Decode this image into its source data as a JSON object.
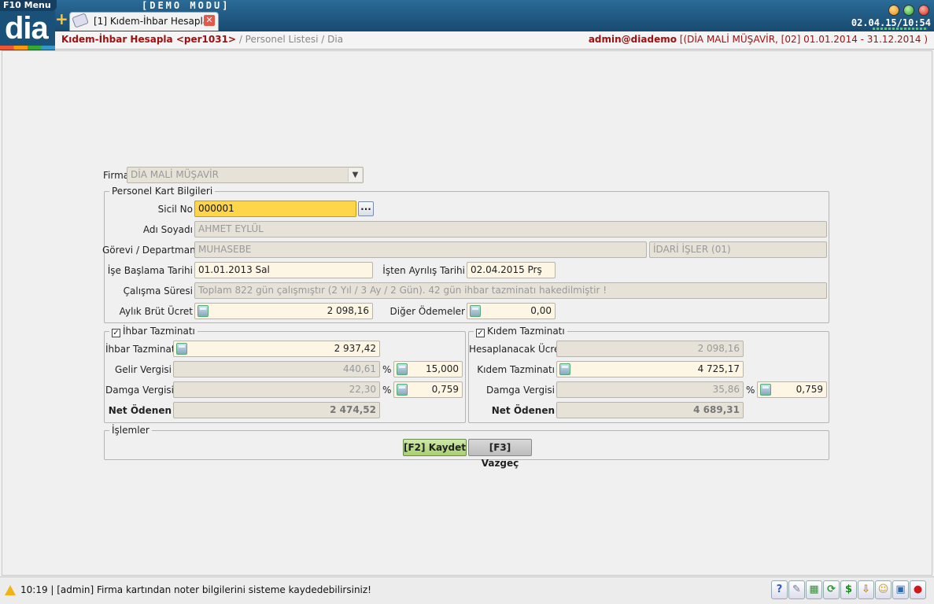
{
  "app": {
    "menu_label": "F10 Menu",
    "logo_text": "dia",
    "demo_label": "[DEMO   MODU]",
    "clock": "02.04.15/10:54"
  },
  "tab": {
    "label": "[1] Kıdem-İhbar Hesapla"
  },
  "breadcrumb": {
    "current": "Kıdem-İhbar Hesapla <per1031>",
    "rest": "/ Personel Listesi / Dia",
    "user": "admin@diademo",
    "context": "[(DİA MALİ MÜŞAVİR, [02] 01.01.2014 - 31.12.2014 )"
  },
  "form": {
    "firma_label": "Firma",
    "firma_value": "DİA MALİ MÜŞAVİR",
    "personel": {
      "title": "Personel Kart Bilgileri",
      "sicil_label": "Sicil No",
      "sicil_value": "000001",
      "adi_label": "Adı Soyadı",
      "adi_value": "AHMET EYLÜL",
      "gorev_label": "Görevi / Departmanı",
      "gorev_value": "MUHASEBE",
      "departman_value": "İDARİ İŞLER (01)",
      "baslama_label": "İşe Başlama Tarihi",
      "baslama_value": "01.01.2013 Sal",
      "ayrilis_label": "İşten Ayrılış Tarihi",
      "ayrilis_value": "02.04.2015 Prş",
      "calisma_label": "Çalışma Süresi",
      "calisma_value": "Toplam 822 gün çalışmıştır (2 Yıl / 3 Ay / 2 Gün). 42 gün ihbar tazminatı hakedilmiştir !",
      "brut_label": "Aylık Brüt Ücret",
      "brut_value": "2 098,16",
      "diger_label": "Diğer Ödemeler",
      "diger_value": "0,00"
    },
    "ihbar": {
      "title": "İhbar Tazminatı",
      "checked": true,
      "tazminat_label": "İhbar Tazminatı",
      "tazminat_value": "2 937,42",
      "gelir_label": "Gelir Vergisi",
      "gelir_value": "440,61",
      "gelir_rate": "15,000",
      "damga_label": "Damga Vergisi",
      "damga_value": "22,30",
      "damga_rate": "0,759",
      "net_label": "Net Ödenen",
      "net_value": "2 474,52"
    },
    "kidem": {
      "title": "Kıdem Tazminatı",
      "checked": true,
      "ucret_label": "Hesaplanacak Ücret",
      "ucret_value": "2 098,16",
      "tazminat_label": "Kıdem Tazminatı",
      "tazminat_value": "4 725,17",
      "damga_label": "Damga Vergisi",
      "damga_value": "35,86",
      "damga_rate": "0,759",
      "net_label": "Net Ödenen",
      "net_value": "4 689,31"
    },
    "pct_symbol": "%",
    "islemler": {
      "title": "İşlemler",
      "save_label": "[F2] Kaydet",
      "cancel_label": "[F3] Vazgeç"
    }
  },
  "status": {
    "message": "10:19 | [admin] Firma kartından noter bilgilerini sisteme kaydedebilirsiniz!",
    "tray_icons": [
      "help-icon",
      "wrench-icon",
      "calculator-icon",
      "refresh-icon",
      "dollar-icon",
      "download-icon",
      "smiley-icon",
      "lock-icon",
      "stop-icon"
    ]
  },
  "colors": {
    "titlebar": "#1e5a86",
    "crumb_accent": "#a01010",
    "active_field": "#ffd54a",
    "save_button": "#a8d070"
  }
}
